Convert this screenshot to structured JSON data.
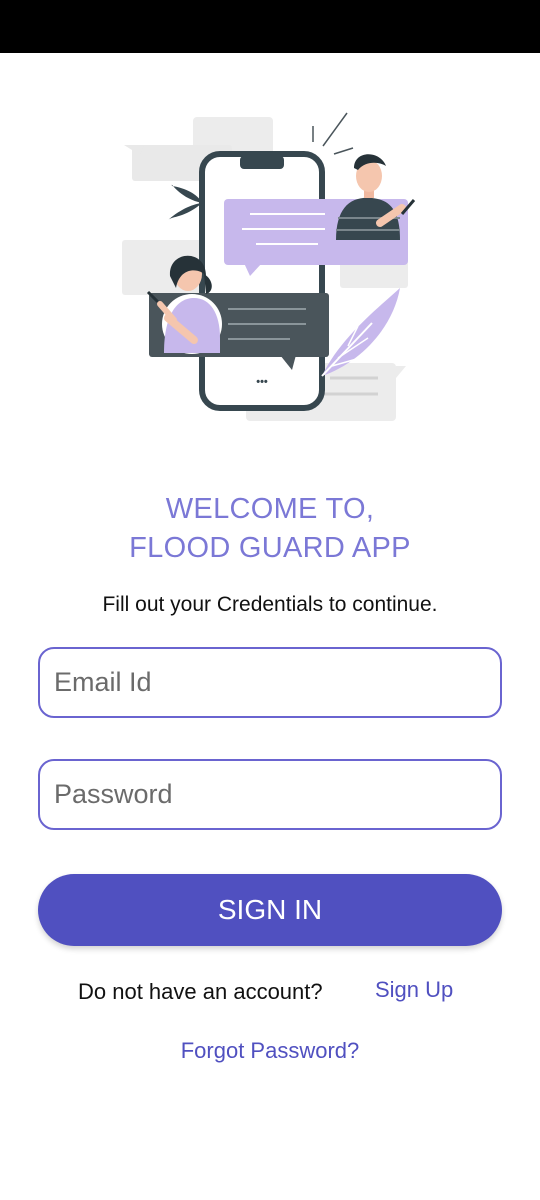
{
  "welcome": {
    "line1": "WELCOME TO,",
    "line2": "FLOOD GUARD APP"
  },
  "subtitle": "Fill out your Credentials to continue.",
  "email": {
    "placeholder": "Email Id",
    "value": ""
  },
  "password": {
    "placeholder": "Password",
    "value": ""
  },
  "signin_label": "SIGN IN",
  "account": {
    "prompt": "Do not have an account?",
    "signup_label": "Sign Up"
  },
  "forgot_label": "Forgot Password?",
  "phone_dots": "•••",
  "illustration": {
    "icon": "chat-phone-illustration"
  },
  "colors": {
    "accent": "#5050C0",
    "title": "#7B78D6",
    "field_border": "#6A64D0",
    "bubble_purple": "#C7B8EC",
    "bubble_dark": "#4A555B"
  }
}
